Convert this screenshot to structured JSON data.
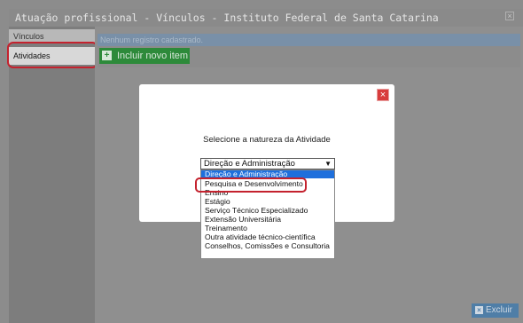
{
  "window": {
    "title": "Atuação profissional - Vínculos - Instituto Federal de Santa Catarina",
    "close_glyph": "×"
  },
  "sidebar": {
    "items": [
      {
        "label": "Vínculos"
      },
      {
        "label": "Atividades"
      }
    ]
  },
  "panel": {
    "empty_message": "Nenhum registro cadastrado.",
    "add_button_label": "Incluir novo item",
    "add_icon_glyph": "+",
    "delete_button_label": "Excluir",
    "delete_icon_glyph": "×"
  },
  "modal": {
    "close_glyph": "×",
    "message": "Selecione a natureza da Atividade",
    "select": {
      "selected_value": "Direção e Administração",
      "options": [
        "Direção e Administração",
        "Pesquisa e Desenvolvimento",
        "Ensino",
        "Estágio",
        "Serviço Técnico Especializado",
        "Extensão Universitária",
        "Treinamento",
        "Outra atividade técnico-científica",
        "Conselhos, Comissões e Consultoria"
      ],
      "highlighted_option_index": 0,
      "annotated_option_index": 1
    }
  },
  "colors": {
    "annotation_red": "#c4222e",
    "add_button_green": "#2d8a3a",
    "delete_button_blue": "#4f7ea7",
    "selection_blue": "#1e6fdc"
  }
}
